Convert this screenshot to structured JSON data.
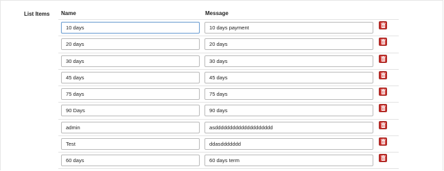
{
  "section": {
    "label": "List Items"
  },
  "columns": {
    "name": "Name",
    "message": "Message"
  },
  "items": [
    {
      "name": "10 days",
      "message": "10 days payment",
      "focused": true
    },
    {
      "name": "20 days",
      "message": "20 days"
    },
    {
      "name": "30 days",
      "message": "30 days"
    },
    {
      "name": "45 days",
      "message": "45 days"
    },
    {
      "name": "75 days",
      "message": "75 days"
    },
    {
      "name": "90 Days",
      "message": "90 days"
    },
    {
      "name": "admin",
      "message": "asdddddddddddddddddddd"
    },
    {
      "name": "Test",
      "message": "ddasddddddd"
    },
    {
      "name": "60 days",
      "message": "60 days term"
    }
  ],
  "icons": {
    "delete": "trash-icon"
  },
  "colors": {
    "delete_button": "#c9302c",
    "focus_border": "#6f9fd1"
  }
}
